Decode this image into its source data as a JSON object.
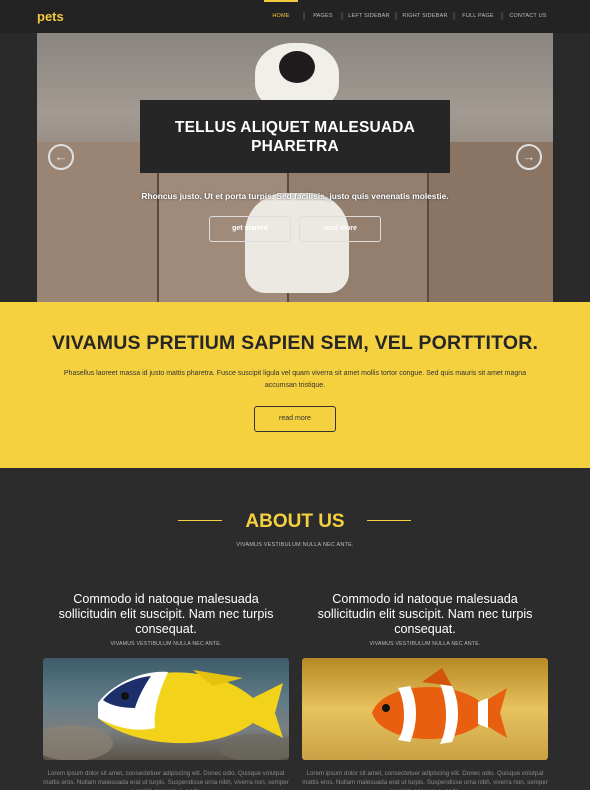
{
  "nav": {
    "logo": "pets",
    "items": [
      {
        "label": "HOME",
        "active": true
      },
      {
        "label": "PAGES",
        "active": false
      },
      {
        "label": "LEFT SIDEBAR",
        "active": false
      },
      {
        "label": "RIGHT SIDEBAR",
        "active": false
      },
      {
        "label": "FULL PAGE",
        "active": false
      },
      {
        "label": "CONTACT US",
        "active": false
      }
    ]
  },
  "hero": {
    "title_line1": "TELLUS ALIQUET MALESUADA",
    "title_line2": "PHARETRA",
    "subtitle": "Rhoncus justo. Ut et porta turpis. Sed facilisis, justo quis venenatis molestie.",
    "btn_primary": "get started",
    "btn_secondary": "read more",
    "prev_icon": "arrow-left-icon",
    "next_icon": "arrow-right-icon"
  },
  "feature": {
    "title": "VIVAMUS PRETIUM SAPIEN SEM, VEL PORTTITOR.",
    "text": "Phasellus laoreet massa id justo mattis pharetra. Fusce suscipit ligula vel quam viverra sit amet mollis tortor congue. Sed quis mauris sit amet magna accumsan tristique.",
    "button": "read more"
  },
  "about": {
    "title": "ABOUT US",
    "subtitle": "VIVAMUS VESTIBULUM NULLA NEC ANTE.",
    "columns": [
      {
        "title": "Commodo id natoque malesuada sollicitudin elit suscipit. Nam nec turpis consequat.",
        "subtitle": "VIVAMUS VESTIBULUM NULLA NEC ANTE.",
        "text": "Lorem ipsum dolor sit amet, consectetuer adipiscing elit. Donec odio. Quisque volutpat mattis eros. Nullam malesuada erat ut turpis. Suspendisse urna nibh, viverra non, semper suscipit, posuere a, pede."
      },
      {
        "title": "Commodo id natoque malesuada sollicitudin elit suscipit. Nam nec turpis consequat.",
        "subtitle": "VIVAMUS VESTIBULUM NULLA NEC ANTE.",
        "text": "Lorem ipsum dolor sit amet, consectetuer adipiscing elit. Donec odio. Quisque volutpat mattis eros. Nullam malesuada erat ut turpis. Suspendisse urna nibh, viverra non, semper suscipit, posuere a, pede."
      }
    ]
  },
  "colors": {
    "accent": "#f5d13f",
    "dark": "#2c2c2c",
    "nav_bg": "#232323"
  }
}
